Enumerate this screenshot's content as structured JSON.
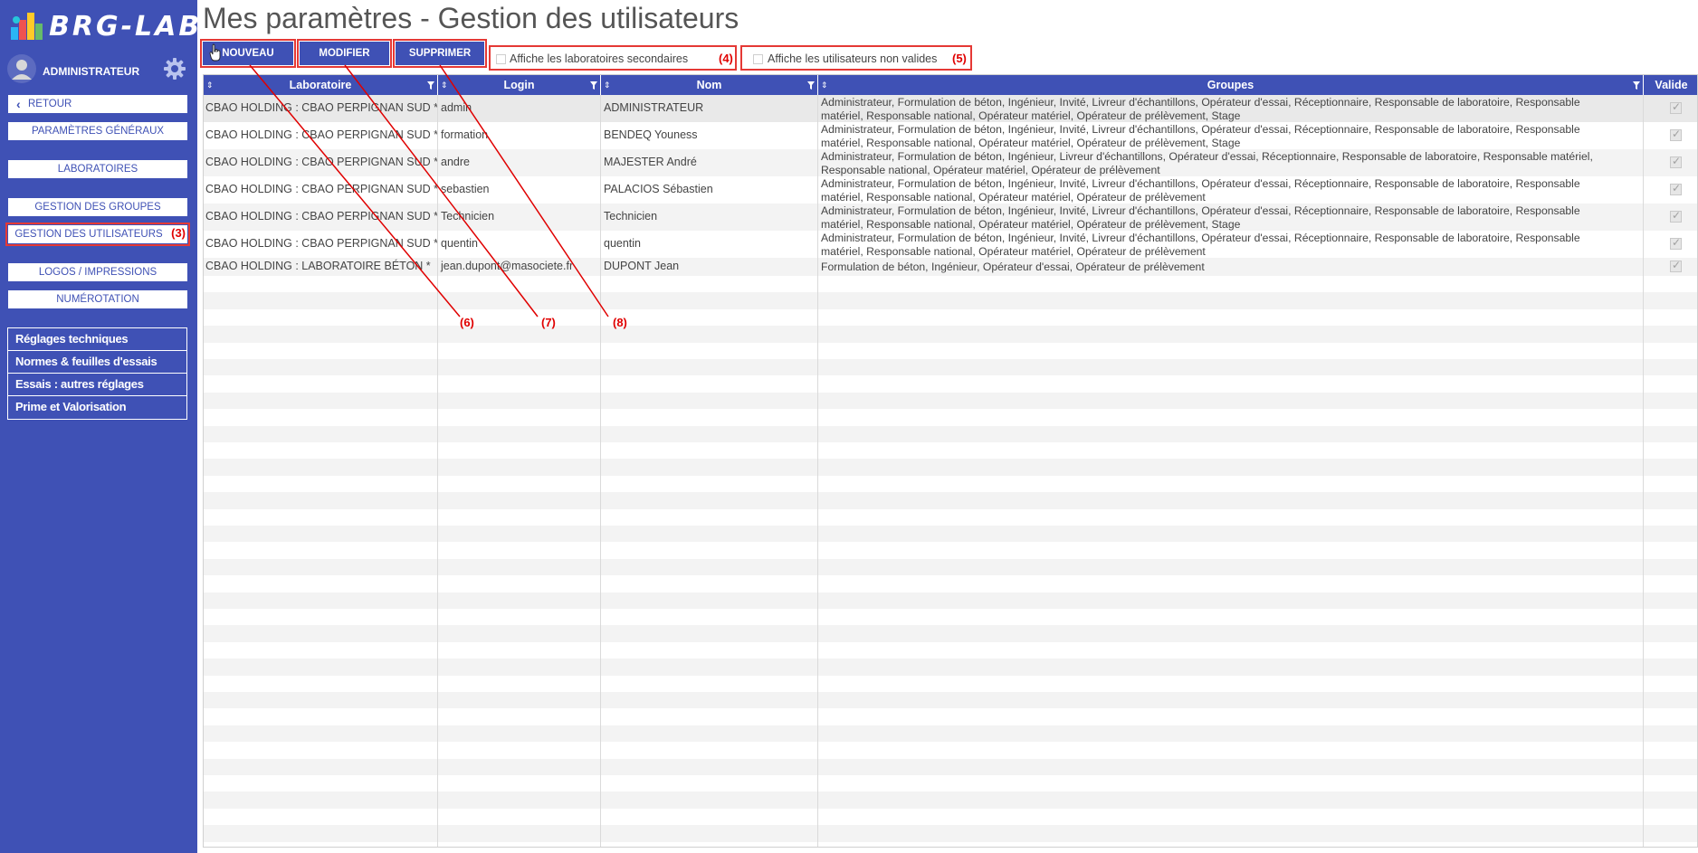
{
  "app": {
    "name": "BRG-LAB"
  },
  "user": {
    "name": "ADMINISTRATEUR"
  },
  "sidebar": {
    "back_label": "RETOUR",
    "items": [
      {
        "label": "PARAMÈTRES GÉNÉRAUX"
      },
      {
        "label": "LABORATOIRES"
      },
      {
        "label": "GESTION DES GROUPES"
      },
      {
        "label": "GESTION DES UTILISATEURS",
        "marker": "(3)"
      },
      {
        "label": "LOGOS / IMPRESSIONS"
      },
      {
        "label": "NUMÉROTATION"
      }
    ],
    "tech_items": [
      {
        "label": "Réglages techniques"
      },
      {
        "label": "Normes & feuilles d'essais"
      },
      {
        "label": "Essais : autres réglages"
      },
      {
        "label": "Prime et Valorisation"
      }
    ]
  },
  "page": {
    "title": "Mes paramètres - Gestion des utilisateurs"
  },
  "toolbar": {
    "new_label": "NOUVEAU",
    "edit_label": "MODIFIER",
    "delete_label": "SUPPRIMER",
    "secondary_labs_label": "Affiche les laboratoires secondaires",
    "secondary_labs_marker": "(4)",
    "invalid_users_label": "Affiche les utilisateurs non valides",
    "invalid_users_marker": "(5)"
  },
  "grid": {
    "columns": [
      "Laboratoire",
      "Login",
      "Nom",
      "Groupes",
      "Valide"
    ],
    "rows": [
      {
        "lab": "CBAO HOLDING : CBAO PERPIGNAN SUD *",
        "login": "admin",
        "nom": "ADMINISTRATEUR",
        "groupes": [
          "Administrateur, Formulation de béton, Ingénieur, Invité, Livreur d'échantillons, Opérateur d'essai, Réceptionnaire, Responsable de laboratoire, Responsable",
          "matériel, Responsable national, Opérateur matériel, Opérateur de prélèvement, Stage"
        ]
      },
      {
        "lab": "CBAO HOLDING : CBAO PERPIGNAN SUD *",
        "login": "formation",
        "nom": "BENDEQ Youness",
        "groupes": [
          "Administrateur, Formulation de béton, Ingénieur, Invité, Livreur d'échantillons, Opérateur d'essai, Réceptionnaire, Responsable de laboratoire, Responsable",
          "matériel, Responsable national, Opérateur matériel, Opérateur de prélèvement, Stage"
        ]
      },
      {
        "lab": "CBAO HOLDING : CBAO PERPIGNAN SUD *",
        "login": "andre",
        "nom": "MAJESTER André",
        "groupes": [
          "Administrateur, Formulation de béton, Ingénieur, Livreur d'échantillons, Opérateur d'essai, Réceptionnaire, Responsable de laboratoire, Responsable matériel,",
          "Responsable national, Opérateur matériel, Opérateur de prélèvement"
        ]
      },
      {
        "lab": "CBAO HOLDING : CBAO PERPIGNAN SUD *",
        "login": "sebastien",
        "nom": "PALACIOS Sébastien",
        "groupes": [
          "Administrateur, Formulation de béton, Ingénieur, Invité, Livreur d'échantillons, Opérateur d'essai, Réceptionnaire, Responsable de laboratoire, Responsable",
          "matériel, Responsable national, Opérateur matériel, Opérateur de prélèvement"
        ]
      },
      {
        "lab": "CBAO HOLDING : CBAO PERPIGNAN SUD *",
        "login": "Technicien",
        "nom": "Technicien",
        "groupes": [
          "Administrateur, Formulation de béton, Ingénieur, Invité, Livreur d'échantillons, Opérateur d'essai, Réceptionnaire, Responsable de laboratoire, Responsable",
          "matériel, Responsable national, Opérateur matériel, Opérateur de prélèvement, Stage"
        ]
      },
      {
        "lab": "CBAO HOLDING : CBAO PERPIGNAN SUD *",
        "login": "quentin",
        "nom": "quentin",
        "groupes": [
          "Administrateur, Formulation de béton, Ingénieur, Invité, Livreur d'échantillons, Opérateur d'essai, Réceptionnaire, Responsable de laboratoire, Responsable",
          "matériel, Responsable national, Opérateur matériel, Opérateur de prélèvement"
        ]
      },
      {
        "lab": "CBAO HOLDING : LABORATOIRE BÉTON *",
        "login": "jean.dupont@masociete.fr",
        "nom": "DUPONT Jean",
        "groupes": [
          "Formulation de béton, Ingénieur, Opérateur d'essai, Opérateur de prélèvement"
        ]
      }
    ]
  },
  "annotations": [
    "(6)",
    "(7)",
    "(8)"
  ],
  "colors": {
    "primary": "#3f51b5",
    "highlight": "#e53935",
    "annotation": "#e00000"
  }
}
